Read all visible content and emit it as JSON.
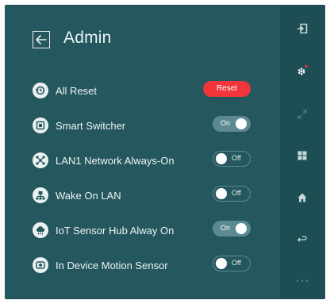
{
  "header": {
    "title": "Admin"
  },
  "rows": [
    {
      "label": "All Reset",
      "control": "button",
      "button_label": "Reset",
      "icon": "reset-icon"
    },
    {
      "label": "Smart Switcher",
      "control": "toggle",
      "state": "On",
      "icon": "switcher-icon"
    },
    {
      "label": "LAN1 Network Always-On",
      "control": "toggle",
      "state": "Off",
      "icon": "network-icon"
    },
    {
      "label": "Wake On LAN",
      "control": "toggle",
      "state": "Off",
      "icon": "lan-icon"
    },
    {
      "label": "IoT Sensor Hub Alway On",
      "control": "toggle",
      "state": "On",
      "icon": "cloud-icon"
    },
    {
      "label": "In Device Motion Sensor",
      "control": "toggle",
      "state": "Off",
      "icon": "motion-sensor-icon"
    }
  ],
  "sidebar": {
    "items": [
      "input-icon",
      "settings-icon",
      "fit-screen-icon",
      "apps-icon",
      "home-icon",
      "back-icon",
      "more-icon"
    ]
  },
  "colors": {
    "panel": "#24575e",
    "sidebar": "#1d4e54",
    "reset_button": "#f2343b",
    "toggle_on": "#5b8a90"
  }
}
